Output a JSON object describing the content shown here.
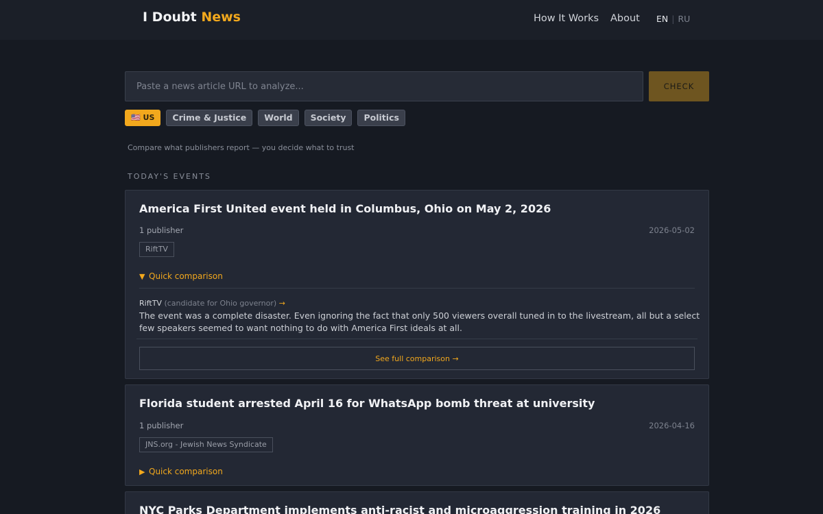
{
  "header": {
    "brand_main": "I Doubt",
    "brand_accent": "News",
    "nav": [
      "How It Works",
      "About"
    ],
    "lang_active": "EN",
    "lang_other": "RU",
    "separator": "|"
  },
  "search": {
    "placeholder": "Paste a news article URL to analyze...",
    "button": "CHECK"
  },
  "tags": [
    {
      "label": "🇺🇸 US",
      "active": true
    },
    {
      "label": "Crime & Justice",
      "active": false
    },
    {
      "label": "World",
      "active": false
    },
    {
      "label": "Society",
      "active": false
    },
    {
      "label": "Politics",
      "active": false
    }
  ],
  "tagline": "Compare what publishers report — you decide what to trust",
  "section_title": "TODAY'S EVENTS",
  "events": [
    {
      "title": "America First United event held in Columbus, Ohio on May 2, 2026",
      "publishers": "1 publisher",
      "date": "2026-05-02",
      "source": "RiftTV",
      "quick_label": "Quick comparison",
      "quick_icon": "▼",
      "comparison": {
        "source": "RiftTV",
        "note": "(candidate for Ohio governor)",
        "arrow": "→",
        "text": "The event was a complete disaster. Even ignoring the fact that only 500 viewers overall tuned in to the livestream, all but a select few speakers seemed to want nothing to do with America First ideals at all."
      },
      "full_label": "See full comparison →"
    },
    {
      "title": "Florida student arrested April 16 for WhatsApp bomb threat at university",
      "publishers": "1 publisher",
      "date": "2026-04-16",
      "source": "JNS.org - Jewish News Syndicate",
      "quick_label": "Quick comparison",
      "quick_icon": "▶"
    },
    {
      "title": "NYC Parks Department implements anti-racist and microaggression training in 2026"
    }
  ],
  "colors": {
    "accent": "#f2a81d",
    "background": "#161a22",
    "card": "#232834"
  }
}
